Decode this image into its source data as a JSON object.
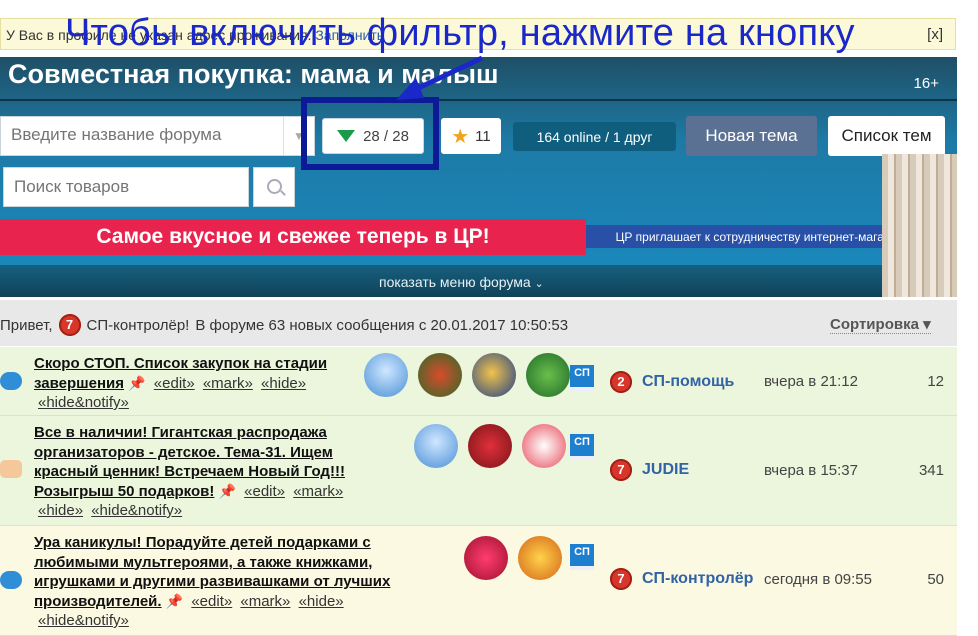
{
  "notice": {
    "text": "У Вас в профиле не указан адрес проживания.",
    "link": "Заполнить",
    "close": "[x]"
  },
  "overlay_hint": "Чтобы включить фильтр, нажмите на кнопку",
  "header": {
    "title": "Совместная покупка: мама и малыш",
    "age": "16+",
    "forum_search_placeholder": "Введите название форума",
    "filter_label": "28 / 28",
    "favorites_count": "11",
    "online_text": "164 online  / 1 друг",
    "new_topic": "Новая тема",
    "topic_list": "Список тем",
    "goods_search_placeholder": "Поиск товаров",
    "banner_main": "Самое вкусное и свежее теперь в ЦР!",
    "banner_side": "ЦР приглашает к сотрудничеству интернет-магазины!",
    "menu_toggle": "показать меню форума"
  },
  "greeting": {
    "prefix": "Привет,",
    "user": "СП-контролёр!",
    "message": "В форуме 63 новых сообщения с 20.01.2017 10:50:53",
    "sort": "Сортировка"
  },
  "topics": [
    {
      "title_line": "Скоро СТОП. Список закупок на стадии завершения",
      "actions": [
        "«edit»",
        "«mark»",
        "«hide»",
        "«hide&notify»"
      ],
      "badge": "2",
      "author": "СП-помощь",
      "time": "вчера в 21:12",
      "count": "12"
    },
    {
      "title_line": "Все в наличии! Гигантская распродажа организаторов - детское. Тема-31. Ищем красный ценник! Встречаем Новый Год!!! Розыгрыш 50 подарков!",
      "actions": [
        "«edit»",
        "«mark»",
        "«hide»",
        "«hide&notify»"
      ],
      "badge": "7",
      "author": "JUDIE",
      "time": "вчера в 15:37",
      "count": "341"
    },
    {
      "title_line": "Ура каникулы! Порадуйте детей подарками с любимыми мультгероями, а также книжками, игрушками и другими развивашками от лучших производителей.",
      "actions": [
        "«edit»",
        "«mark»",
        "«hide»",
        "«hide&notify»"
      ],
      "badge": "7",
      "author": "СП-контролёр",
      "time": "сегодня в 09:55",
      "count": "50"
    }
  ],
  "sp_badge": "СП"
}
